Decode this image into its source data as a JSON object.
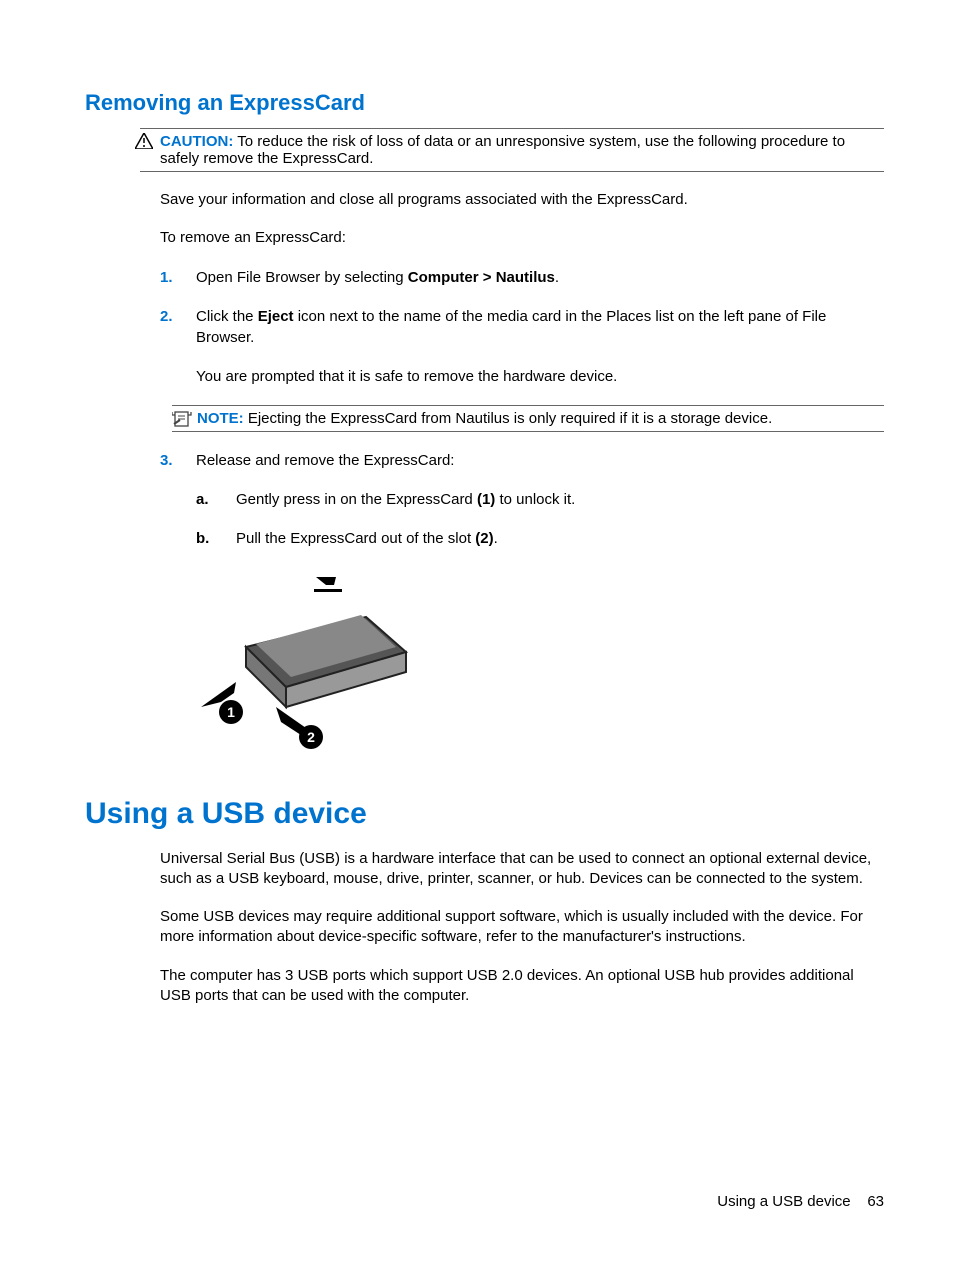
{
  "section1": {
    "heading": "Removing an ExpressCard",
    "caution": {
      "label": "CAUTION:",
      "text": "To reduce the risk of loss of data or an unresponsive system, use the following procedure to safely remove the ExpressCard."
    },
    "para1": "Save your information and close all programs associated with the ExpressCard.",
    "para2": "To remove an ExpressCard:",
    "steps": {
      "s1_a": "Open File Browser by selecting ",
      "s1_b": "Computer > Nautilus",
      "s1_c": ".",
      "s2_a": "Click the ",
      "s2_b": "Eject",
      "s2_c": " icon next to the name of the media card in the Places list on the left pane of File Browser.",
      "s2_p2": "You are prompted that it is safe to remove the hardware device.",
      "note": {
        "label": "NOTE:",
        "text": "Ejecting the ExpressCard from Nautilus is only required if it is a storage device."
      },
      "s3": "Release and remove the ExpressCard:",
      "s3a_a": "Gently press in on the ExpressCard ",
      "s3a_b": "(1)",
      "s3a_c": " to unlock it.",
      "s3b_a": "Pull the ExpressCard out of the slot ",
      "s3b_b": "(2)",
      "s3b_c": "."
    }
  },
  "section2": {
    "heading": "Using a USB device",
    "para1": "Universal Serial Bus (USB) is a hardware interface that can be used to connect an optional external device, such as a USB keyboard, mouse, drive, printer, scanner, or hub. Devices can be connected to the system.",
    "para2": "Some USB devices may require additional support software, which is usually included with the device. For more information about device-specific software, refer to the manufacturer's instructions.",
    "para3": "The computer has 3 USB ports which support USB 2.0 devices. An optional USB hub provides additional USB ports that can be used with the computer."
  },
  "footer": {
    "title": "Using a USB device",
    "page": "63"
  }
}
